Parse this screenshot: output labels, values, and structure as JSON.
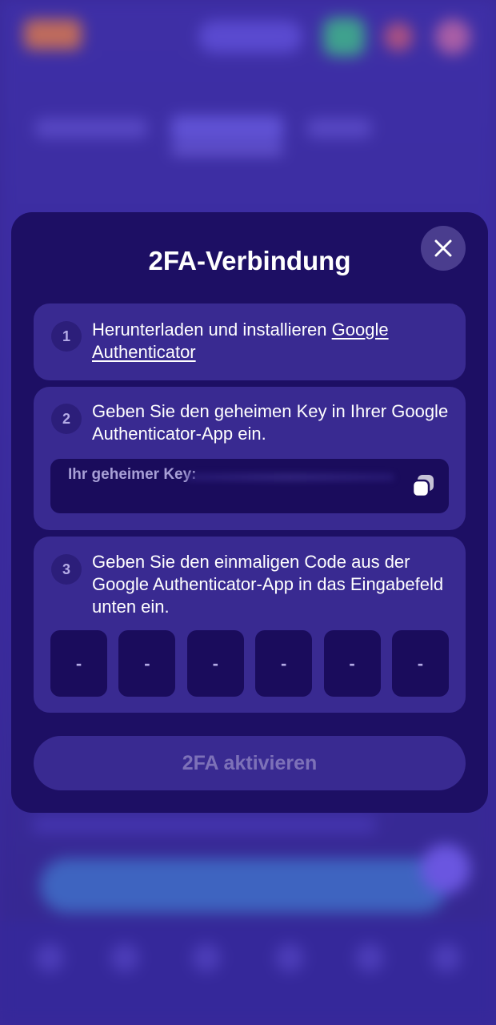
{
  "modal": {
    "title": "2FA-Verbindung",
    "close_icon": "close-icon",
    "steps": [
      {
        "number": "1",
        "text": "Herunterladen und installieren ",
        "link_text": "Google Authenticator"
      },
      {
        "number": "2",
        "text": "Geben Sie den geheimen Key in Ihrer Google Authenticator-App ein.",
        "secret_label": "Ihr geheimer Key:",
        "copy_icon": "copy-icon"
      },
      {
        "number": "3",
        "text": "Geben Sie den einmaligen Code aus der Google Authenticator-App in das Eingabefeld unten ein.",
        "otp_digits": [
          "-",
          "-",
          "-",
          "-",
          "-",
          "-"
        ]
      }
    ],
    "submit_label": "2FA aktivieren"
  },
  "colors": {
    "backdrop": "#3a2a9a",
    "modal_bg": "#1d0f64",
    "card_bg": "#392a91",
    "input_bg": "#1a0c5c",
    "close_bg": "#4a3d8e",
    "disabled_text": "#7d71b8"
  }
}
